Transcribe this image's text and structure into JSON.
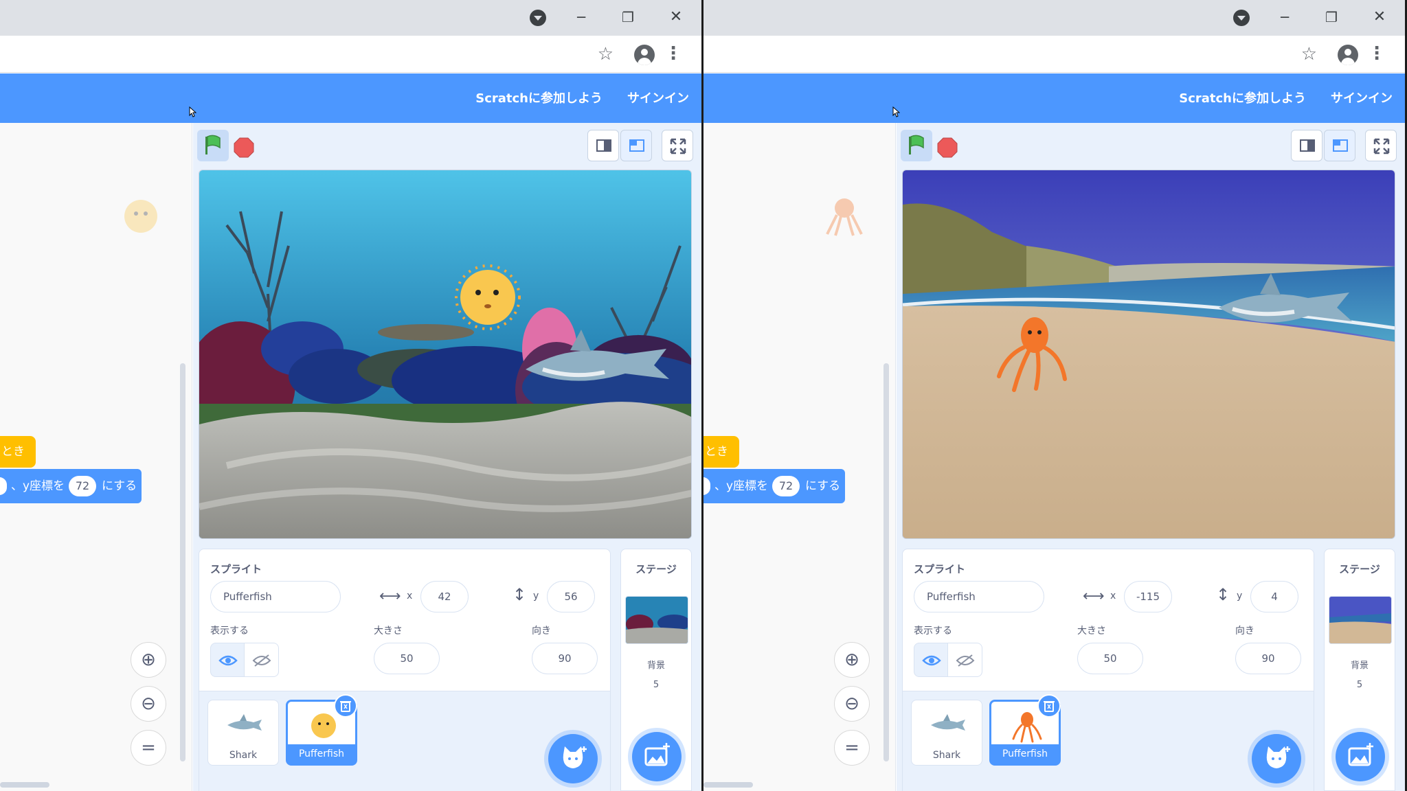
{
  "panes": [
    {
      "menu": {
        "join": "Scratchに参加しよう",
        "signin": "サインイン"
      },
      "workspace": {
        "event_block": "とき",
        "motion_prefix": "、y座標を",
        "motion_value": "72",
        "motion_suffix": "にする"
      },
      "sprite": {
        "section_label": "スプライト",
        "name": "Pufferfish",
        "x_label": "x",
        "x": "42",
        "y_label": "y",
        "y": "56",
        "show_label": "表示する",
        "size_label": "大きさ",
        "size": "50",
        "direction_label": "向き",
        "direction": "90"
      },
      "sprite_list": [
        {
          "name": "Shark"
        },
        {
          "name": "Pufferfish"
        }
      ],
      "stage": {
        "label": "ステージ",
        "backdrops_label": "背景",
        "backdrops_count": "5",
        "scene": "underwater"
      }
    },
    {
      "menu": {
        "join": "Scratchに参加しよう",
        "signin": "サインイン"
      },
      "workspace": {
        "event_block": "とき",
        "motion_prefix": "、y座標を",
        "motion_value": "72",
        "motion_suffix": "にする"
      },
      "sprite": {
        "section_label": "スプライト",
        "name": "Pufferfish",
        "x_label": "x",
        "x": "-115",
        "y_label": "y",
        "y": "4",
        "show_label": "表示する",
        "size_label": "大きさ",
        "size": "50",
        "direction_label": "向き",
        "direction": "90"
      },
      "sprite_list": [
        {
          "name": "Shark"
        },
        {
          "name": "Pufferfish"
        }
      ],
      "stage": {
        "label": "ステージ",
        "backdrops_label": "背景",
        "backdrops_count": "5",
        "scene": "beach"
      }
    }
  ],
  "colors": {
    "scratch_blue": "#4c97ff",
    "events_yellow": "#ffbf00",
    "flag_green": "#4cbf56",
    "stop_red": "#ec5959",
    "pufferfish_yellow": "#f9c74f",
    "octopus_orange": "#f3762a"
  },
  "icons": [
    "chrome-dropdown-icon",
    "minimize-icon",
    "maximize-icon",
    "close-icon",
    "star-icon",
    "profile-icon",
    "menu-kebab-icon",
    "green-flag-icon",
    "stop-icon",
    "small-stage-icon",
    "normal-stage-icon",
    "fullscreen-icon",
    "zoom-in-icon",
    "zoom-out-icon",
    "zoom-reset-icon",
    "eye-icon",
    "eye-off-icon",
    "x-arrows-icon",
    "y-arrows-icon",
    "trash-icon",
    "choose-sprite-icon",
    "choose-backdrop-icon"
  ]
}
